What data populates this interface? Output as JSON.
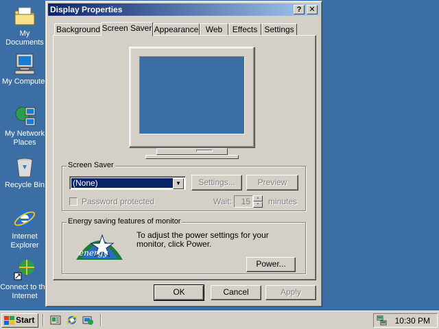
{
  "desktop": {
    "icons": [
      {
        "label": "My Documents",
        "icon": "folder-icon"
      },
      {
        "label": "My Computer",
        "icon": "computer-icon"
      },
      {
        "label": "My Network Places",
        "icon": "network-icon"
      },
      {
        "label": "Recycle Bin",
        "icon": "recycle-bin-icon"
      },
      {
        "label": "Internet Explorer",
        "icon": "ie-icon"
      },
      {
        "label": "Connect to the Internet",
        "icon": "connect-icon"
      }
    ]
  },
  "window": {
    "title": "Display Properties",
    "help_glyph": "?",
    "close_glyph": "✕",
    "tabs": [
      "Background",
      "Screen Saver",
      "Appearance",
      "Web",
      "Effects",
      "Settings"
    ],
    "active_tab": "Screen Saver",
    "screensaver": {
      "group_label": "Screen Saver",
      "selected": "(None)",
      "settings_label": "Settings...",
      "preview_label": "Preview",
      "password_label": "Password protected",
      "wait_label": "Wait:",
      "wait_value": "15",
      "minutes_label": "minutes"
    },
    "energy": {
      "group_label": "Energy saving features of monitor",
      "description": "To adjust the power settings for your monitor, click Power.",
      "power_label": "Power..."
    },
    "buttons": {
      "ok": "OK",
      "cancel": "Cancel",
      "apply": "Apply"
    }
  },
  "taskbar": {
    "start_label": "Start",
    "clock": "10:30 PM"
  },
  "colors": {
    "desktop": "#3a6ea5",
    "title_start": "#0a246a",
    "title_end": "#a6caf0",
    "face": "#d4d0c8"
  }
}
